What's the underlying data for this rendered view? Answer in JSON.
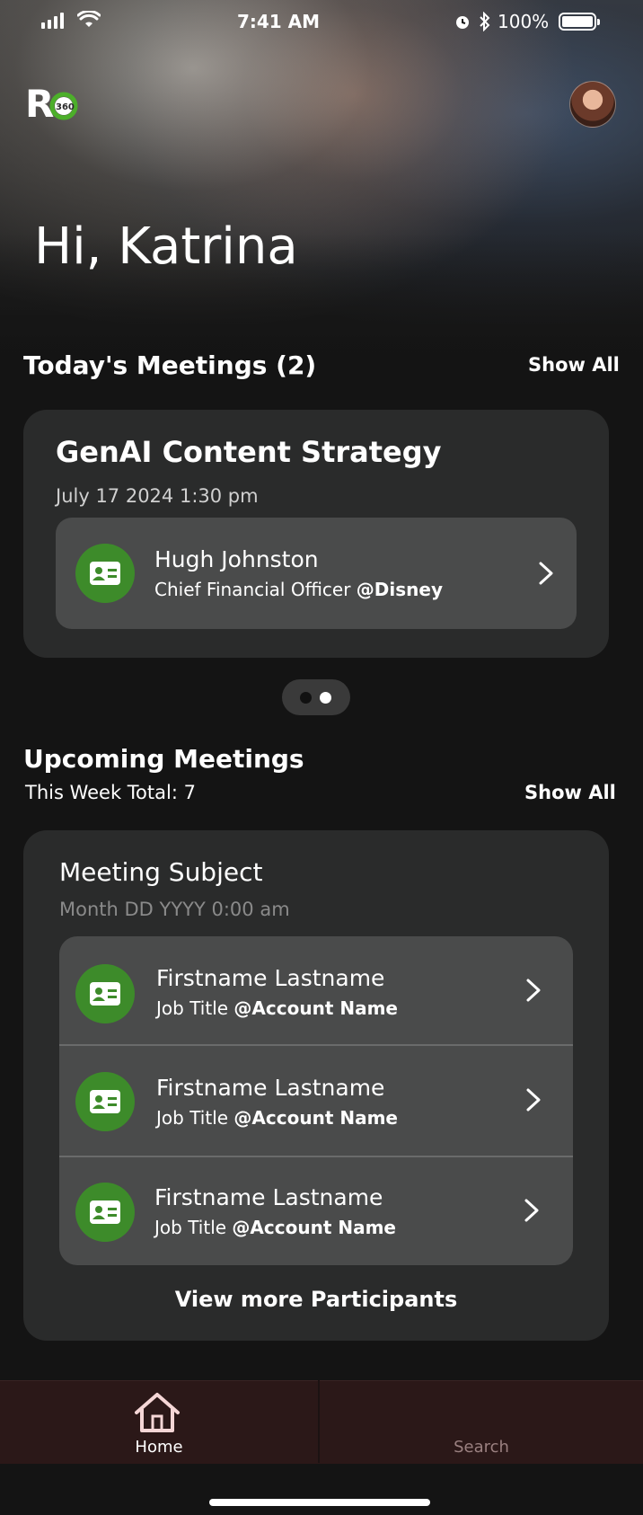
{
  "status_bar": {
    "time": "7:41 AM",
    "battery": "100%"
  },
  "header": {
    "logo": "R360"
  },
  "greeting": "Hi, Katrina",
  "todays_meetings": {
    "title": "Today's Meetings (2)",
    "show_all": "Show All",
    "card": {
      "subject": "GenAI Content Strategy",
      "datetime": "July 17 2024 1:30 pm",
      "participant": {
        "name": "Hugh Johnston",
        "title": "Chief Financial Officer",
        "account": "@Disney"
      }
    }
  },
  "upcoming_meetings": {
    "title": "Upcoming Meetings",
    "subtitle": "This Week Total: 7",
    "show_all": "Show All",
    "card": {
      "subject": "Meeting Subject",
      "datetime": "Month DD YYYY 0:00 am",
      "participants": [
        {
          "name": "Firstname Lastname",
          "title": "Job Title",
          "account": "@Account Name"
        },
        {
          "name": "Firstname Lastname",
          "title": "Job Title",
          "account": "@Account Name"
        },
        {
          "name": "Firstname Lastname",
          "title": "Job Title",
          "account": "@Account Name"
        }
      ],
      "view_more": "View more Participants"
    }
  },
  "tab_bar": {
    "home": "Home",
    "search": "Search"
  },
  "colors": {
    "accent_green": "#3d8b2a",
    "tab_bar_bg": "#2b1818"
  }
}
